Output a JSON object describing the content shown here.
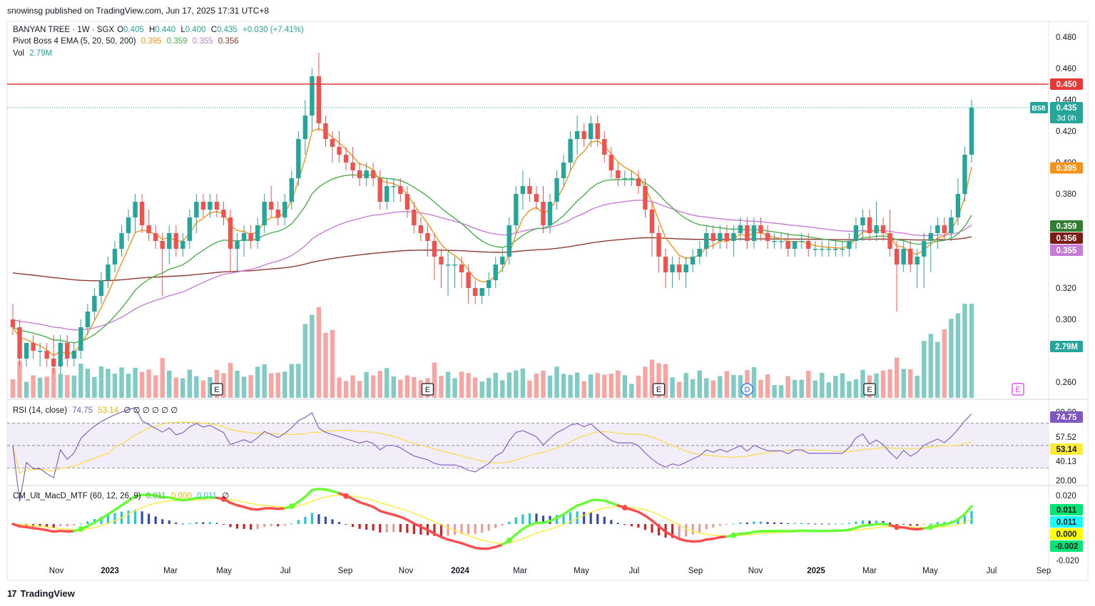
{
  "publisher_line": "snowinsg published on TradingView.com, Jun 17, 2025 17:31 UTC+8",
  "footer_brand": "TradingView",
  "legend_main": {
    "symbol": "BANYAN TREE · 1W · SGX",
    "o_label": "O",
    "o": "0.405",
    "h_label": "H",
    "h": "0.440",
    "l_label": "L",
    "l": "0.400",
    "c_label": "C",
    "c": "0.435",
    "change": "+0.030 (+7.41%)"
  },
  "legend_ema": {
    "name": "Pivot Boss 4 EMA (5, 20, 50, 200)",
    "v1": "0.395",
    "v2": "0.359",
    "v3": "0.355",
    "v4": "0.356"
  },
  "legend_vol": {
    "name": "Vol",
    "value": "2.79M"
  },
  "legend_rsi": {
    "name": "RSI (14, close)",
    "v1": "74.75",
    "v2": "53.14",
    "rest": "∅ ∅ ∅ ∅ ∅ ∅"
  },
  "legend_macd": {
    "name": "CM_Ult_MacD_MTF (60, 12, 26, 9)",
    "v1": "0.011",
    "v2": "0.000",
    "v3": "0.011",
    "rest": "∅"
  },
  "colors": {
    "up": "#26a69a",
    "down": "#ef5350",
    "vol_up": "#80cbc4",
    "vol_down": "#f7a5a3",
    "ema5": "#f7931a",
    "ema20": "#4caf50",
    "ema50": "#c77dd7",
    "ema200": "#8d3a2f",
    "resistance": "#e53935",
    "rsi_line": "#7e57c2",
    "rsi_ma": "#fdd835"
  },
  "chart_data": {
    "type": "candlestick",
    "interval": "1W",
    "ylim": [
      0.25,
      0.49
    ],
    "price_ticks": [
      "0.480",
      "0.460",
      "0.440",
      "0.420",
      "0.400",
      "0.380",
      "0.320",
      "0.300",
      "0.260"
    ],
    "resistance_level": 0.45,
    "resistance_label": "0.450",
    "current_price_label": "0.435",
    "current_countdown": "3d 0h",
    "current_tag": "B58",
    "ema_labels": {
      "ema5": "0.395",
      "ema20": "0.359",
      "ema200": "0.356",
      "ema50": "0.355"
    },
    "volume_label": "2.79M",
    "x_labels": [
      "Nov",
      "2023",
      "Mar",
      "May",
      "Jul",
      "Sep",
      "Nov",
      "2024",
      "Mar",
      "May",
      "Jul",
      "Sep",
      "Nov",
      "2025",
      "Mar",
      "May",
      "Jul",
      "Sep"
    ],
    "candles": [
      [
        0.3,
        0.31,
        0.29,
        0.295
      ],
      [
        0.295,
        0.3,
        0.27,
        0.275
      ],
      [
        0.275,
        0.285,
        0.27,
        0.285
      ],
      [
        0.285,
        0.29,
        0.275,
        0.28
      ],
      [
        0.28,
        0.285,
        0.27,
        0.28
      ],
      [
        0.28,
        0.285,
        0.27,
        0.275
      ],
      [
        0.275,
        0.29,
        0.265,
        0.27
      ],
      [
        0.27,
        0.29,
        0.265,
        0.285
      ],
      [
        0.285,
        0.29,
        0.27,
        0.275
      ],
      [
        0.275,
        0.285,
        0.27,
        0.28
      ],
      [
        0.28,
        0.3,
        0.275,
        0.295
      ],
      [
        0.295,
        0.31,
        0.29,
        0.305
      ],
      [
        0.305,
        0.32,
        0.3,
        0.315
      ],
      [
        0.315,
        0.33,
        0.31,
        0.325
      ],
      [
        0.325,
        0.34,
        0.32,
        0.335
      ],
      [
        0.335,
        0.35,
        0.33,
        0.345
      ],
      [
        0.345,
        0.36,
        0.34,
        0.355
      ],
      [
        0.355,
        0.37,
        0.35,
        0.365
      ],
      [
        0.365,
        0.38,
        0.355,
        0.375
      ],
      [
        0.375,
        0.38,
        0.355,
        0.36
      ],
      [
        0.36,
        0.37,
        0.35,
        0.355
      ],
      [
        0.355,
        0.36,
        0.345,
        0.35
      ],
      [
        0.35,
        0.355,
        0.315,
        0.345
      ],
      [
        0.345,
        0.36,
        0.335,
        0.355
      ],
      [
        0.355,
        0.36,
        0.34,
        0.345
      ],
      [
        0.345,
        0.355,
        0.34,
        0.35
      ],
      [
        0.35,
        0.37,
        0.345,
        0.365
      ],
      [
        0.365,
        0.38,
        0.355,
        0.375
      ],
      [
        0.375,
        0.38,
        0.365,
        0.37
      ],
      [
        0.37,
        0.38,
        0.365,
        0.375
      ],
      [
        0.375,
        0.38,
        0.365,
        0.37
      ],
      [
        0.37,
        0.375,
        0.36,
        0.365
      ],
      [
        0.365,
        0.37,
        0.33,
        0.345
      ],
      [
        0.345,
        0.355,
        0.33,
        0.35
      ],
      [
        0.35,
        0.36,
        0.34,
        0.355
      ],
      [
        0.355,
        0.36,
        0.345,
        0.35
      ],
      [
        0.35,
        0.365,
        0.345,
        0.36
      ],
      [
        0.36,
        0.38,
        0.355,
        0.375
      ],
      [
        0.375,
        0.385,
        0.365,
        0.37
      ],
      [
        0.37,
        0.375,
        0.36,
        0.365
      ],
      [
        0.365,
        0.38,
        0.36,
        0.375
      ],
      [
        0.375,
        0.395,
        0.37,
        0.39
      ],
      [
        0.39,
        0.42,
        0.385,
        0.415
      ],
      [
        0.415,
        0.44,
        0.405,
        0.43
      ],
      [
        0.43,
        0.46,
        0.42,
        0.455
      ],
      [
        0.455,
        0.47,
        0.42,
        0.425
      ],
      [
        0.425,
        0.43,
        0.41,
        0.415
      ],
      [
        0.415,
        0.42,
        0.4,
        0.41
      ],
      [
        0.41,
        0.42,
        0.4,
        0.405
      ],
      [
        0.405,
        0.41,
        0.395,
        0.4
      ],
      [
        0.4,
        0.41,
        0.39,
        0.395
      ],
      [
        0.395,
        0.4,
        0.385,
        0.39
      ],
      [
        0.39,
        0.4,
        0.385,
        0.395
      ],
      [
        0.395,
        0.4,
        0.385,
        0.39
      ],
      [
        0.39,
        0.395,
        0.37,
        0.375
      ],
      [
        0.375,
        0.39,
        0.37,
        0.385
      ],
      [
        0.385,
        0.39,
        0.375,
        0.385
      ],
      [
        0.385,
        0.39,
        0.375,
        0.38
      ],
      [
        0.38,
        0.385,
        0.365,
        0.37
      ],
      [
        0.37,
        0.375,
        0.355,
        0.36
      ],
      [
        0.36,
        0.365,
        0.35,
        0.355
      ],
      [
        0.355,
        0.36,
        0.34,
        0.35
      ],
      [
        0.35,
        0.355,
        0.325,
        0.34
      ],
      [
        0.34,
        0.345,
        0.32,
        0.335
      ],
      [
        0.335,
        0.345,
        0.315,
        0.335
      ],
      [
        0.335,
        0.34,
        0.32,
        0.335
      ],
      [
        0.335,
        0.34,
        0.32,
        0.33
      ],
      [
        0.33,
        0.335,
        0.31,
        0.32
      ],
      [
        0.32,
        0.325,
        0.31,
        0.315
      ],
      [
        0.315,
        0.32,
        0.31,
        0.32
      ],
      [
        0.32,
        0.33,
        0.315,
        0.325
      ],
      [
        0.325,
        0.34,
        0.32,
        0.335
      ],
      [
        0.335,
        0.345,
        0.33,
        0.34
      ],
      [
        0.34,
        0.365,
        0.335,
        0.36
      ],
      [
        0.36,
        0.385,
        0.355,
        0.38
      ],
      [
        0.38,
        0.395,
        0.37,
        0.385
      ],
      [
        0.385,
        0.39,
        0.375,
        0.38
      ],
      [
        0.38,
        0.385,
        0.37,
        0.375
      ],
      [
        0.375,
        0.385,
        0.355,
        0.36
      ],
      [
        0.36,
        0.38,
        0.355,
        0.375
      ],
      [
        0.375,
        0.395,
        0.37,
        0.39
      ],
      [
        0.39,
        0.405,
        0.385,
        0.4
      ],
      [
        0.4,
        0.42,
        0.395,
        0.415
      ],
      [
        0.415,
        0.43,
        0.405,
        0.42
      ],
      [
        0.42,
        0.425,
        0.41,
        0.415
      ],
      [
        0.415,
        0.43,
        0.41,
        0.425
      ],
      [
        0.425,
        0.43,
        0.41,
        0.415
      ],
      [
        0.415,
        0.42,
        0.4,
        0.405
      ],
      [
        0.405,
        0.41,
        0.39,
        0.395
      ],
      [
        0.395,
        0.4,
        0.385,
        0.39
      ],
      [
        0.39,
        0.395,
        0.385,
        0.39
      ],
      [
        0.39,
        0.395,
        0.385,
        0.39
      ],
      [
        0.39,
        0.395,
        0.38,
        0.385
      ],
      [
        0.385,
        0.39,
        0.365,
        0.37
      ],
      [
        0.37,
        0.375,
        0.34,
        0.355
      ],
      [
        0.355,
        0.36,
        0.33,
        0.34
      ],
      [
        0.34,
        0.345,
        0.32,
        0.33
      ],
      [
        0.33,
        0.34,
        0.32,
        0.335
      ],
      [
        0.335,
        0.34,
        0.325,
        0.33
      ],
      [
        0.33,
        0.34,
        0.32,
        0.335
      ],
      [
        0.335,
        0.345,
        0.33,
        0.34
      ],
      [
        0.34,
        0.35,
        0.335,
        0.345
      ],
      [
        0.345,
        0.36,
        0.34,
        0.355
      ],
      [
        0.355,
        0.36,
        0.345,
        0.35
      ],
      [
        0.35,
        0.36,
        0.345,
        0.355
      ],
      [
        0.355,
        0.36,
        0.345,
        0.35
      ],
      [
        0.35,
        0.36,
        0.34,
        0.355
      ],
      [
        0.355,
        0.365,
        0.35,
        0.36
      ],
      [
        0.36,
        0.365,
        0.345,
        0.35
      ],
      [
        0.35,
        0.365,
        0.345,
        0.36
      ],
      [
        0.36,
        0.365,
        0.35,
        0.355
      ],
      [
        0.355,
        0.36,
        0.345,
        0.35
      ],
      [
        0.35,
        0.355,
        0.345,
        0.35
      ],
      [
        0.35,
        0.355,
        0.345,
        0.35
      ],
      [
        0.35,
        0.355,
        0.34,
        0.345
      ],
      [
        0.345,
        0.35,
        0.34,
        0.35
      ],
      [
        0.35,
        0.355,
        0.345,
        0.35
      ],
      [
        0.35,
        0.355,
        0.34,
        0.345
      ],
      [
        0.345,
        0.35,
        0.34,
        0.345
      ],
      [
        0.345,
        0.35,
        0.34,
        0.345
      ],
      [
        0.345,
        0.35,
        0.34,
        0.345
      ],
      [
        0.345,
        0.35,
        0.34,
        0.345
      ],
      [
        0.345,
        0.35,
        0.34,
        0.345
      ],
      [
        0.345,
        0.355,
        0.34,
        0.35
      ],
      [
        0.35,
        0.365,
        0.345,
        0.36
      ],
      [
        0.36,
        0.37,
        0.35,
        0.365
      ],
      [
        0.365,
        0.37,
        0.35,
        0.355
      ],
      [
        0.355,
        0.375,
        0.35,
        0.36
      ],
      [
        0.36,
        0.365,
        0.35,
        0.355
      ],
      [
        0.355,
        0.37,
        0.34,
        0.345
      ],
      [
        0.345,
        0.35,
        0.305,
        0.335
      ],
      [
        0.335,
        0.35,
        0.33,
        0.345
      ],
      [
        0.345,
        0.35,
        0.33,
        0.335
      ],
      [
        0.335,
        0.345,
        0.32,
        0.34
      ],
      [
        0.34,
        0.355,
        0.32,
        0.35
      ],
      [
        0.35,
        0.36,
        0.33,
        0.355
      ],
      [
        0.355,
        0.365,
        0.345,
        0.36
      ],
      [
        0.36,
        0.365,
        0.35,
        0.355
      ],
      [
        0.355,
        0.37,
        0.35,
        0.365
      ],
      [
        0.365,
        0.39,
        0.36,
        0.38
      ],
      [
        0.38,
        0.41,
        0.375,
        0.405
      ],
      [
        0.405,
        0.44,
        0.4,
        0.435
      ]
    ]
  },
  "rsi": {
    "ticks": [
      "80.00",
      "57.52",
      "40.13",
      "20.00"
    ],
    "labels": {
      "rsi": "74.75",
      "ma": "53.14"
    },
    "upper": 70,
    "lower": 30
  },
  "macd": {
    "ticks": [
      "0.020",
      "0.011",
      "0.011",
      "0.000",
      "-0.002",
      "-0.020"
    ],
    "labels": {
      "a": "0.011",
      "b": "0.011",
      "c": "0.000",
      "d": "-0.002"
    }
  },
  "event_markers": [
    {
      "type": "E",
      "week": 30
    },
    {
      "type": "E",
      "week": 61
    },
    {
      "type": "E",
      "week": 95
    },
    {
      "type": "D",
      "week": 108
    },
    {
      "type": "E",
      "week": 126
    },
    {
      "type": "E",
      "week": 160
    },
    {
      "type": "D",
      "week": 172
    },
    {
      "type": "E",
      "week": 190
    }
  ]
}
